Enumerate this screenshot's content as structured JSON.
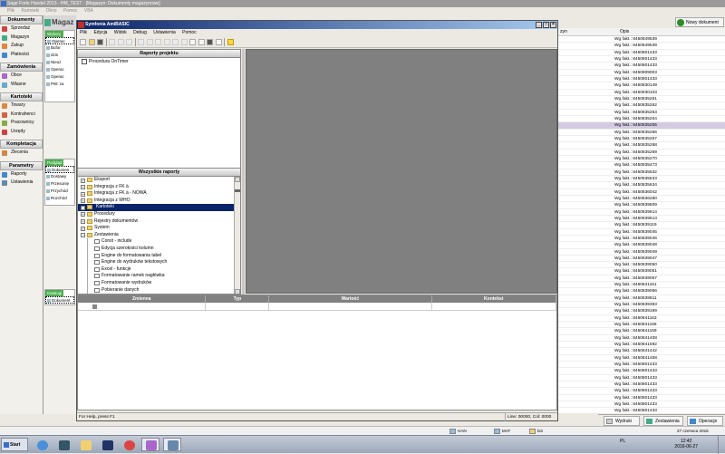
{
  "main_window": {
    "title": "Sage Forte Handel 2013 - HM_TEST - [Magazyn: Dokumenty magazynowe]",
    "menu": [
      "Plik",
      "Kartoteki",
      "Okno",
      "Pomoc",
      "VBA"
    ]
  },
  "left_nav": {
    "sections": [
      {
        "header": "Dokumenty",
        "items": [
          "Sprzedaż",
          "Magazyn",
          "Zakup",
          "Płatności"
        ]
      },
      {
        "header": "Zamówienia",
        "items": [
          "Obce",
          "Własne"
        ]
      },
      {
        "header": "Kartoteki",
        "items": [
          "Towary",
          "Kontrahenci",
          "Pracownicy",
          "Urzędy"
        ]
      },
      {
        "header": "Kompletacja",
        "items": [
          "Zlecenia"
        ]
      },
      {
        "header": "Parametry",
        "items": [
          "Raporty",
          "Ustawienia"
        ]
      }
    ]
  },
  "magazyn_panel": {
    "header": "Magaz",
    "groups": [
      {
        "label": "Wybory",
        "items": [
          "Operac",
          "Bufor",
          "dzis",
          "Nieuż",
          "Operac",
          "Operac",
          "PW: za"
        ]
      },
      {
        "label": "Podgląd",
        "items": [
          "Dokumen",
          "Dostawy",
          "Przesunię",
          "Przychód",
          "Rozchód"
        ]
      },
      {
        "label": "Katalogi",
        "items": [
          "Dokument"
        ]
      }
    ]
  },
  "background_list": {
    "new_document_label": "Nowy dokument",
    "column_headers": [
      "zyn",
      "Opis"
    ],
    "rows": [
      "Wg fakt.: 8450849539",
      "Wg fakt.: 8450849539",
      "Wg fakt.: 8450801433",
      "Wg fakt.: 8450801433",
      "Wg fakt.: 8450801433",
      "Wg fakt.: 8450809003",
      "Wg fakt.: 8450801433",
      "Wg fakt.: 8450830149",
      "Wg fakt.: 8450830103",
      "Wg fakt.: 8450835261",
      "Wg fakt.: 8450835262",
      "Wg fakt.: 8450835263",
      "Wg fakt.: 8450835264",
      "Wg fakt.: 8450835265",
      "Wg fakt.: 8450835266",
      "Wg fakt.: 8450835267",
      "Wg fakt.: 8450835268",
      "Wg fakt.: 8450835269",
      "Wg fakt.: 8450835270",
      "Wg fakt.: 8450835473",
      "Wg fakt.: 8450835632",
      "Wg fakt.: 8450835633",
      "Wg fakt.: 8450835634",
      "Wg fakt.: 8450836042",
      "Wg fakt.: 8450836280",
      "Wg fakt.: 8450839609",
      "Wg fakt.: 8450839614",
      "Wg fakt.: 8450839613",
      "Wg fakt.: 8450839119",
      "Wg fakt.: 8450839045",
      "Wg fakt.: 8450839046",
      "Wg fakt.: 8450839048",
      "Wg fakt.: 8450839049",
      "Wg fakt.: 8450839047",
      "Wg fakt.: 8450839050",
      "Wg fakt.: 8450839051",
      "Wg fakt.: 8450839057",
      "Wg fakt.: 8450841161",
      "Wg fakt.: 8450839056",
      "Wg fakt.: 8450839811",
      "Wg fakt.: 8450839383",
      "Wg fakt.: 8450839199",
      "Wg fakt.: 8450841163",
      "Wg fakt.: 8450841166",
      "Wg fakt.: 8450841169",
      "Wg fakt.: 8450841408",
      "Wg fakt.: 8450841592",
      "Wg fakt.: 8450841442",
      "Wg fakt.: 8450841458",
      "Wg fakt.: 8450801433",
      "Wg fakt.: 8450801433",
      "Wg fakt.: 8450801433",
      "Wg fakt.: 8450801433",
      "Wg fakt.: 8450801433",
      "Wg fakt.: 8450801433",
      "Wg fakt.: 8450801433",
      "Wg fakt.: 8450801433"
    ],
    "highlighted_index": 13,
    "bottom_tabs": [
      "Wydruki",
      "Zestawienia",
      "Operacje"
    ]
  },
  "amibasic": {
    "title": "Symfonia AmiBASIC",
    "window_controls": [
      "_",
      "□",
      "×"
    ],
    "menu": [
      "Plik",
      "Edycja",
      "Widok",
      "Debug",
      "Ustawienia",
      "Pomoc"
    ],
    "project_reports": {
      "header": "Raporty projektu",
      "items": [
        "Procedura OnTimer"
      ]
    },
    "all_reports": {
      "header": "Wszystkie raporty",
      "items": [
        {
          "label": "Eksport",
          "level": 0,
          "expander": "+"
        },
        {
          "label": "Integracja z FK ä",
          "level": 0,
          "expander": "+"
        },
        {
          "label": "Integracja z FK ä - NOWA",
          "level": 0,
          "expander": "+"
        },
        {
          "label": "Integracja z WHO",
          "level": 0,
          "expander": "+"
        },
        {
          "label": "Kartoteki",
          "level": 0,
          "expander": "+",
          "selected": true
        },
        {
          "label": "Procedury",
          "level": 0,
          "expander": "+"
        },
        {
          "label": "Rejestry dokumentów",
          "level": 0,
          "expander": "+"
        },
        {
          "label": "System",
          "level": 0,
          "expander": "+"
        },
        {
          "label": "Zestawienia",
          "level": 0,
          "expander": "−"
        },
        {
          "label": "Const - include",
          "level": 1,
          "expander": ""
        },
        {
          "label": "Edycja szerokości kolumn",
          "level": 1,
          "expander": ""
        },
        {
          "label": "Engine do formatowania tabel",
          "level": 1,
          "expander": ""
        },
        {
          "label": "Engine do wydruków tekstowych",
          "level": 1,
          "expander": ""
        },
        {
          "label": "Excel - funkcje",
          "level": 1,
          "expander": ""
        },
        {
          "label": "Formatowanie ramek nagłówka",
          "level": 1,
          "expander": ""
        },
        {
          "label": "Formatowanie wydruków",
          "level": 1,
          "expander": ""
        },
        {
          "label": "Pobieranie danych",
          "level": 1,
          "expander": ""
        }
      ]
    },
    "variables": {
      "columns": [
        "Zmienna",
        "Typ",
        "Wartość",
        "Kontekst"
      ]
    },
    "status": {
      "help": "For Help, press F1",
      "position": "Line: 00000, Col: 0000"
    }
  },
  "taskbar_apps": [
    {
      "label": "HAN"
    },
    {
      "label": "MAT"
    },
    {
      "label": "bin"
    }
  ],
  "taskbar": {
    "start_label": "Start",
    "language": "PL",
    "time": "12:42",
    "date": "2016-06-27",
    "day_label": "27 czerwca 2016"
  },
  "colors": {
    "selection": "#0a246a",
    "highlight_row": "#d4cbe2",
    "green_label": "#4caf50",
    "editor_bg": "#808080"
  }
}
